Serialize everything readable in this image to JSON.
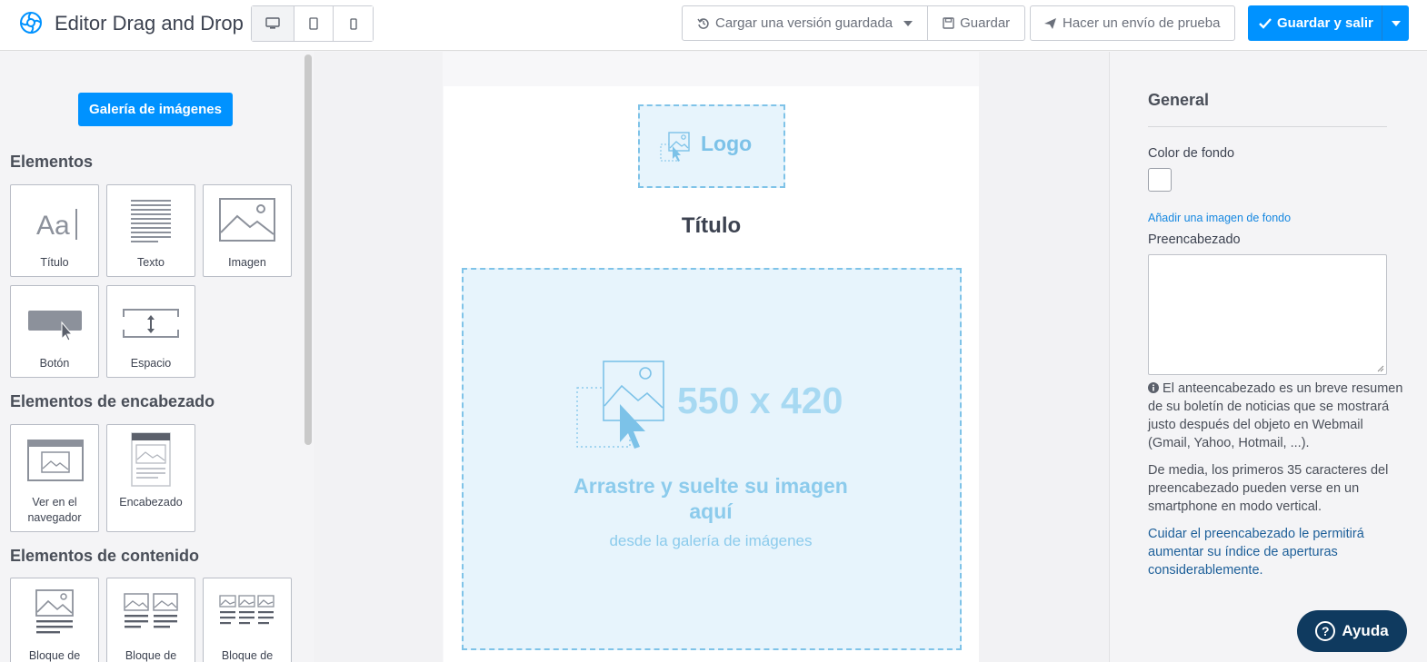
{
  "app": {
    "title": "Editor Drag and Drop"
  },
  "toolbar": {
    "devices": [
      "desktop-icon",
      "tablet-icon",
      "mobile-icon"
    ],
    "load_version": "Cargar una versión guardada",
    "save": "Guardar",
    "send_test": "Hacer un envío de prueba",
    "save_exit": "Guardar y salir"
  },
  "left_panel": {
    "gallery_button": "Galería de imágenes",
    "sections": [
      {
        "title": "Elementos",
        "items": [
          "Título",
          "Texto",
          "Imagen",
          "Botón",
          "Espacio"
        ]
      },
      {
        "title": "Elementos de encabezado",
        "items": [
          "Ver en el navegador",
          "Encabezado"
        ]
      },
      {
        "title": "Elementos de contenido",
        "items": [
          "Bloque de",
          "Bloque de",
          "Bloque de"
        ]
      }
    ]
  },
  "canvas": {
    "logo": "Logo",
    "title": "Título",
    "image_size": "550 x 420",
    "drop_text": "Arrastre y suelte su imagen aquí",
    "drop_sub": "desde la galería de imágenes"
  },
  "right_panel": {
    "heading": "General",
    "background_color_label": "Color de fondo",
    "background_color_value": "#ffffff",
    "add_bg_image": "Añadir una imagen de fondo",
    "preheader_label": "Preencabezado",
    "preheader_value": "",
    "info_text": "El anteencabezado es un breve resumen de su boletín de noticias que se mostrará justo después del objeto en Webmail (Gmail, Yahoo, Hotmail, ...).",
    "avg_text": "De media, los primeros 35 caracteres del preencabezado pueden verse en un smartphone en modo vertical.",
    "tip_text": "Cuidar el preencabezado le permitirá aumentar su índice de aperturas considerablemente."
  },
  "help": {
    "label": "Ayuda"
  },
  "colors": {
    "accent": "#0092ff",
    "help_bg": "#0f3a5f",
    "placeholder": "#7cc2e8"
  }
}
